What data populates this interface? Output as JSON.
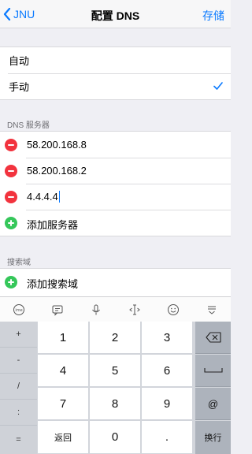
{
  "nav": {
    "back_label": "JNU",
    "title": "配置 DNS",
    "save_label": "存储"
  },
  "mode_group": {
    "items": [
      {
        "label": "自动",
        "checked": false
      },
      {
        "label": "手动",
        "checked": true
      }
    ]
  },
  "dns_section": {
    "header": "DNS 服务器",
    "servers": [
      "58.200.168.8",
      "58.200.168.2",
      "4.4.4.4"
    ],
    "add_label": "添加服务器"
  },
  "search_section": {
    "header": "搜索域",
    "add_label": "添加搜索域"
  },
  "keyboard_toolbar": {
    "icons": [
      "input-method-icon",
      "emoji-text-icon",
      "microphone-icon",
      "cursor-move-icon",
      "smiley-icon",
      "dismiss-keyboard-icon"
    ]
  },
  "keypad": {
    "side_keys": [
      "+",
      "-",
      "/",
      ":",
      "="
    ],
    "digits": [
      "1",
      "2",
      "3",
      "4",
      "5",
      "6",
      "7",
      "8",
      "9"
    ],
    "back_label": "返回",
    "zero": "0",
    "dot": ".",
    "at": "@",
    "return_label": "换行"
  },
  "colors": {
    "accent": "#0a7aff",
    "delete": "#f2333e",
    "add": "#35c75a"
  }
}
